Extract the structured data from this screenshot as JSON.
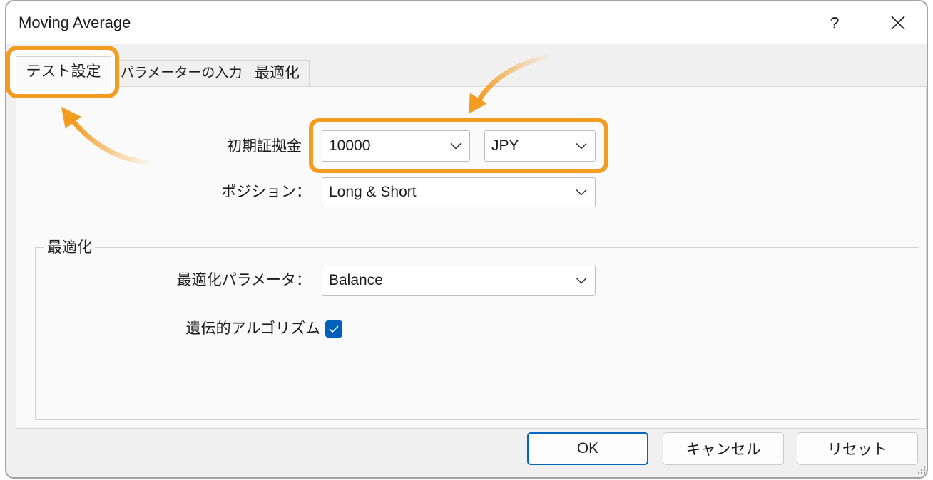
{
  "window": {
    "title": "Moving Average",
    "help_label": "?"
  },
  "icons": {
    "close": "close-icon",
    "dropdown": "chevron-down-icon",
    "checkbox": "checkmark-icon",
    "resize": "resize-grip-icon",
    "annotation": "arrow-icon"
  },
  "tabs": [
    {
      "label": "テスト設定",
      "active": true
    },
    {
      "label": "パラメーターの入力",
      "active": false
    },
    {
      "label": "最適化",
      "active": false
    }
  ],
  "test_settings": {
    "initial_deposit": {
      "label": "初期証拠金",
      "amount": "10000",
      "currency": "JPY"
    },
    "position": {
      "label": "ポジション：",
      "value": "Long & Short"
    }
  },
  "optimization": {
    "group_title": "最適化",
    "parameter": {
      "label": "最適化パラメータ：",
      "value": "Balance"
    },
    "genetic_algorithm": {
      "label": "遺伝的アルゴリズム",
      "checked": true
    }
  },
  "buttons": {
    "ok": "OK",
    "cancel": "キャンセル",
    "reset": "リセット"
  },
  "colors": {
    "highlight": "#f39c1f",
    "checkbox": "#005fb8",
    "default_button_border": "#0067c0"
  }
}
